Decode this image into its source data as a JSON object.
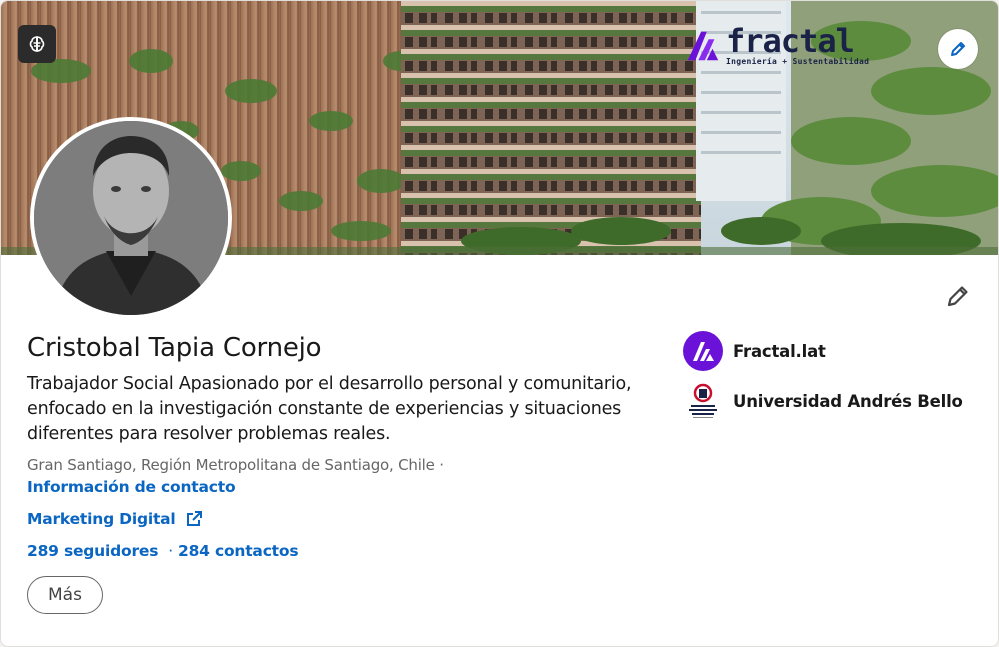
{
  "banner": {
    "brand_name": "fractal",
    "brand_tagline": "Ingeniería + Sustentabilidad"
  },
  "profile": {
    "name": "Cristobal Tapia Cornejo",
    "headline": "Trabajador Social Apasionado por el desarrollo personal y comunitario, enfocado en la investigación constante de experiencias y situaciones diferentes para resolver problemas reales.",
    "location": "Gran Santiago, Región Metropolitana de Santiago, Chile ·",
    "contact_link": "Información de contacto",
    "website_label": "Marketing Digital",
    "followers": "289 seguidores",
    "connections_sep": "·",
    "connections": "284 contactos",
    "more_button": "Más"
  },
  "organizations": [
    {
      "name": "Fractal.lat",
      "icon": "fractal-logo"
    },
    {
      "name": "Universidad Andrés Bello",
      "icon": "unab-logo"
    }
  ],
  "colors": {
    "link": "#0a66c2",
    "fractal_purple": "#6b12d9",
    "unab_red": "#c8102e"
  }
}
